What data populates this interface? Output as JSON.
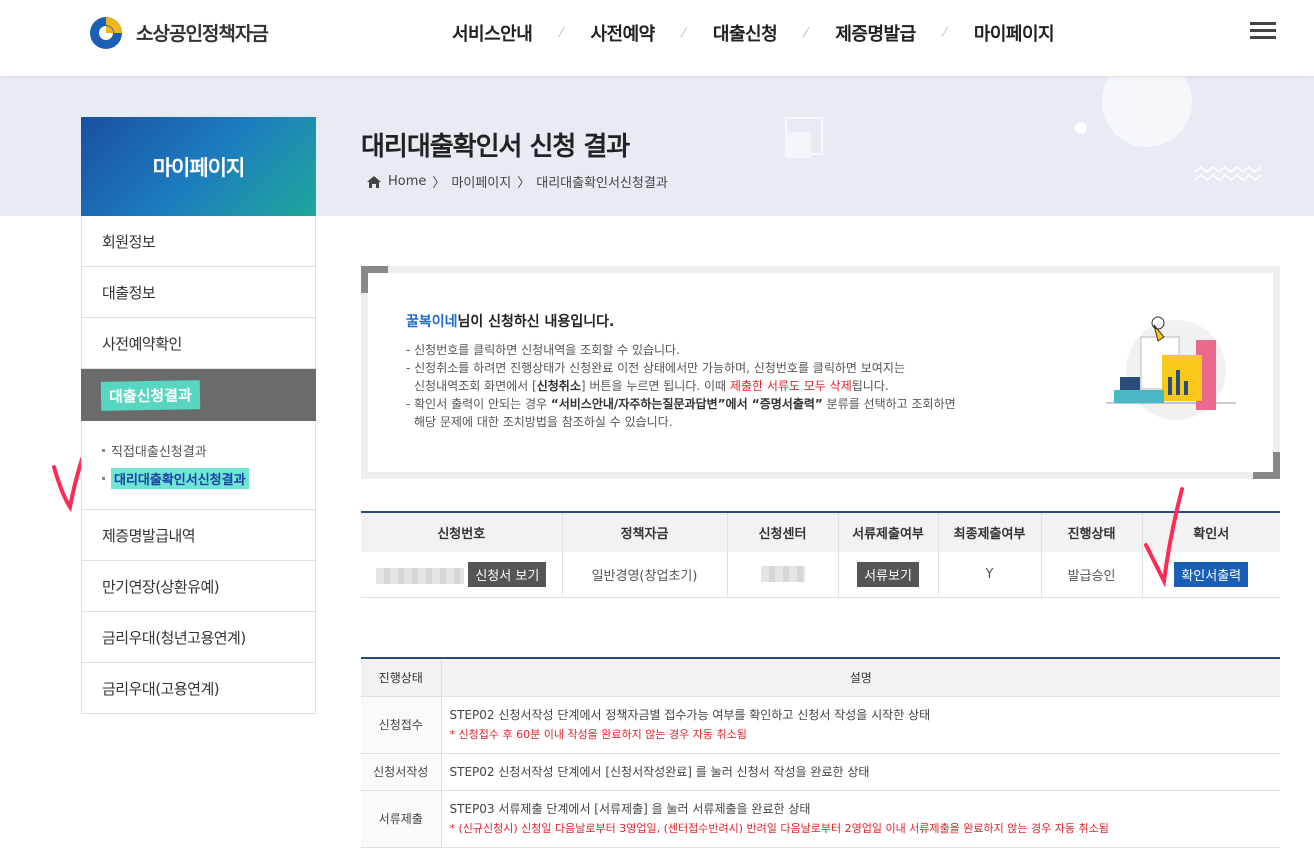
{
  "header": {
    "logo_text": "소상공인정책자금",
    "nav": [
      "서비스안내",
      "사전예약",
      "대출신청",
      "제증명발급",
      "마이페이지"
    ]
  },
  "sidebar": {
    "title": "마이페이지",
    "items_top": [
      "회원정보",
      "대출정보",
      "사전예약확인"
    ],
    "active": "대출신청결과",
    "sub": [
      "직접대출신청결과",
      "대리대출확인서신청결과"
    ],
    "items_bottom": [
      "제증명발급내역",
      "만기연장(상환유예)",
      "금리우대(청년고용연계)",
      "금리우대(고용연계)"
    ]
  },
  "page": {
    "title": "대리대출확인서 신청 결과",
    "breadcrumb": [
      "Home",
      "마이페이지",
      "대리대출확인서신청결과"
    ]
  },
  "info": {
    "user": "꿀복이네",
    "head_suffix": "님이 신청하신 내용입니다.",
    "line1": "- 신청번호를 클릭하면 신청내역을 조회할 수 있습니다.",
    "line2a": "- 신청취소를 하려면 진행상태가 신청완료 이전 상태에서만 가능하며, 신청번호를 클릭하면 보여지는",
    "line2b_pre": "신청내역조회 화면에서 [",
    "line2b_bold": "신청취소",
    "line2b_mid": "] 버튼을 누르면 됩니다. 이때 ",
    "line2b_red": "제출한 서류도 모두 삭제",
    "line2b_end": "됩니다.",
    "line3a_pre": "- 확인서 출력이 안되는 경우 ",
    "line3a_bold": "“서비스안내/자주하는질문과답변”에서 “증명서출력”",
    "line3a_end": " 분류를 선택하고 조회하면",
    "line3b": "해당 문제에 대한 조치방법을 참조하실 수 있습니다."
  },
  "result_table": {
    "headers": [
      "신청번호",
      "정책자금",
      "신청센터",
      "서류제출여부",
      "최종제출여부",
      "진행상태",
      "확인서"
    ],
    "row": {
      "view_btn": "신청서 보기",
      "fund": "일반경영(창업초기)",
      "doc_btn": "서류보기",
      "final": "Y",
      "status": "발급승인",
      "print_btn": "확인서출력"
    }
  },
  "status_table": {
    "headers": [
      "진행상태",
      "설명"
    ],
    "rows": [
      {
        "label": "신청접수",
        "desc": "STEP02 신청서작성 단계에서 정책자금별 접수가능 여부를 확인하고 신청서 작성을 시작한 상태",
        "note": "* 신청접수 후 60분 이내 작성을 완료하지 않는 경우 자동 취소됨"
      },
      {
        "label": "신청서작성",
        "desc": "STEP02 신청서작성 단계에서 [신청서작성완료] 를 눌러 신청서 작성을 완료한 상태",
        "note": ""
      },
      {
        "label": "서류제출",
        "desc": "STEP03 서류제출 단계에서 [서류제출] 을 눌러 서류제출을 완료한 상태",
        "note": "* (신규신청시) 신청일 다음날로부터 3영업일, (센터접수반려시) 반려일 다음날로부터 2영업일 이내 서류제출을 완료하지 않는 경우 자동 취소됨"
      }
    ]
  },
  "colors": {
    "brand_blue": "#1a5fb4",
    "teal_highlight": "#58d6c0",
    "table_top_border": "#2a4c7d",
    "warning_red": "#e0242a"
  }
}
